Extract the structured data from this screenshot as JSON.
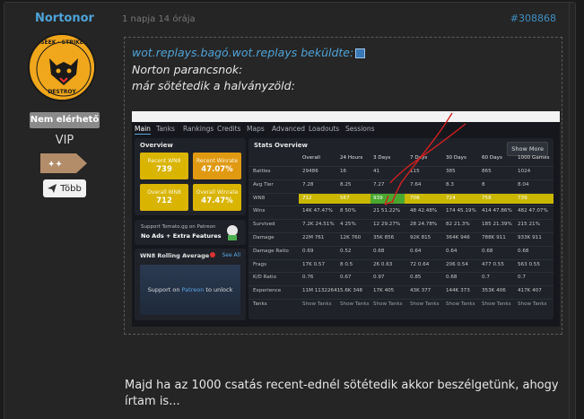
{
  "user": {
    "name": "Nortonor",
    "status": "Nem elérhető",
    "rank": "VIP",
    "more_label": "Több",
    "avatar_top_text": "SEEK · STRIKE",
    "avatar_bottom_text": "DESTROY"
  },
  "post": {
    "timestamp": "1 napja 14 órája",
    "id": "#308868",
    "reply": "Majd ha az 1000 csatás recent-ednél sötétedik akkor beszélgetünk, ahogy írtam is..."
  },
  "quote": {
    "author_line": "wot.replays.bagó.wot.replays beküldte:",
    "line1": "Norton parancsnok:",
    "line2": "már sötétedik a halványzöld:"
  },
  "shot": {
    "tabs": [
      "Main",
      "Tanks",
      "Rankings",
      "Credits",
      "Maps",
      "Advanced",
      "Loadouts",
      "Sessions"
    ],
    "overview_title": "Overview",
    "cards": [
      {
        "label": "Recent WN8",
        "value": "739",
        "color": "#d9b400"
      },
      {
        "label": "Recent Winrate",
        "value": "47.07%",
        "color": "#e09a12"
      },
      {
        "label": "Overall WN8",
        "value": "712",
        "color": "#d9b400"
      },
      {
        "label": "Overall Winrate",
        "value": "47.47%",
        "color": "#d9b400"
      }
    ],
    "support_line1": "Support Tomato.gg on Patreon",
    "support_line2": "No Ads + Extra Features",
    "rolling_title": "WN8 Rolling Average",
    "see_all": "See All",
    "unlock_text": "Support on",
    "unlock_link": "Patreon",
    "unlock_tail": "to unlock",
    "stats_title": "Stats Overview",
    "show_more": "Show More",
    "columns": [
      "Overall",
      "24 Hours",
      "3 Days",
      "7 Days",
      "30 Days",
      "60 Days",
      "1000 Games"
    ],
    "rows": [
      {
        "label": "Battles",
        "cells": [
          "29486",
          "16",
          "41",
          "115",
          "385",
          "865",
          "1024"
        ]
      },
      {
        "label": "Avg Tier",
        "cells": [
          "7.28",
          "8.25",
          "7.27",
          "7.64",
          "8.3",
          "8",
          "8.04"
        ]
      },
      {
        "label": "WN8",
        "cells": [
          "712",
          "567",
          "939",
          "708",
          "724",
          "758",
          "739"
        ]
      },
      {
        "label": "Wins",
        "cells": [
          "14K  47.47%",
          "8  50%",
          "21  51.22%",
          "48  42.48%",
          "174  45.19%",
          "414  47.86%",
          "482  47.07%"
        ]
      },
      {
        "label": "Survived",
        "cells": [
          "7.2K  24.51%",
          "4  25%",
          "12  29.27%",
          "28  24.78%",
          "82  21.3%",
          "185  21.39%",
          "215  21%"
        ]
      },
      {
        "label": "Damage",
        "cells": [
          "22M  761",
          "12K  760",
          "35K  856",
          "92K  815",
          "364K  946",
          "788K  911",
          "933K  911"
        ]
      },
      {
        "label": "Damage Ratio",
        "cells": [
          "0.69",
          "0.52",
          "0.68",
          "0.64",
          "0.64",
          "0.68",
          "0.68"
        ]
      },
      {
        "label": "Frags",
        "cells": [
          "17K  0.57",
          "8  0.5",
          "26  0.63",
          "72  0.64",
          "206  0.54",
          "477  0.55",
          "563  0.55"
        ]
      },
      {
        "label": "K/D Ratio",
        "cells": [
          "0.76",
          "0.67",
          "0.97",
          "0.85",
          "0.68",
          "0.7",
          "0.7"
        ]
      },
      {
        "label": "Experience",
        "cells": [
          "11M  11322641",
          "5.6K  348",
          "17K  405",
          "43K  377",
          "144K  373",
          "353K  406",
          "417K  407"
        ]
      },
      {
        "label": "Tanks",
        "cells": [
          "Show Tanks",
          "Show Tanks",
          "Show Tanks",
          "Show Tanks",
          "Show Tanks",
          "Show Tanks",
          "Show Tanks"
        ]
      }
    ]
  },
  "colors": {
    "accent_blue": "#4ea3d8",
    "wn8_yellow": "#c9b700",
    "wn8_green": "#4aa82f",
    "arrow_red": "#d22020"
  }
}
